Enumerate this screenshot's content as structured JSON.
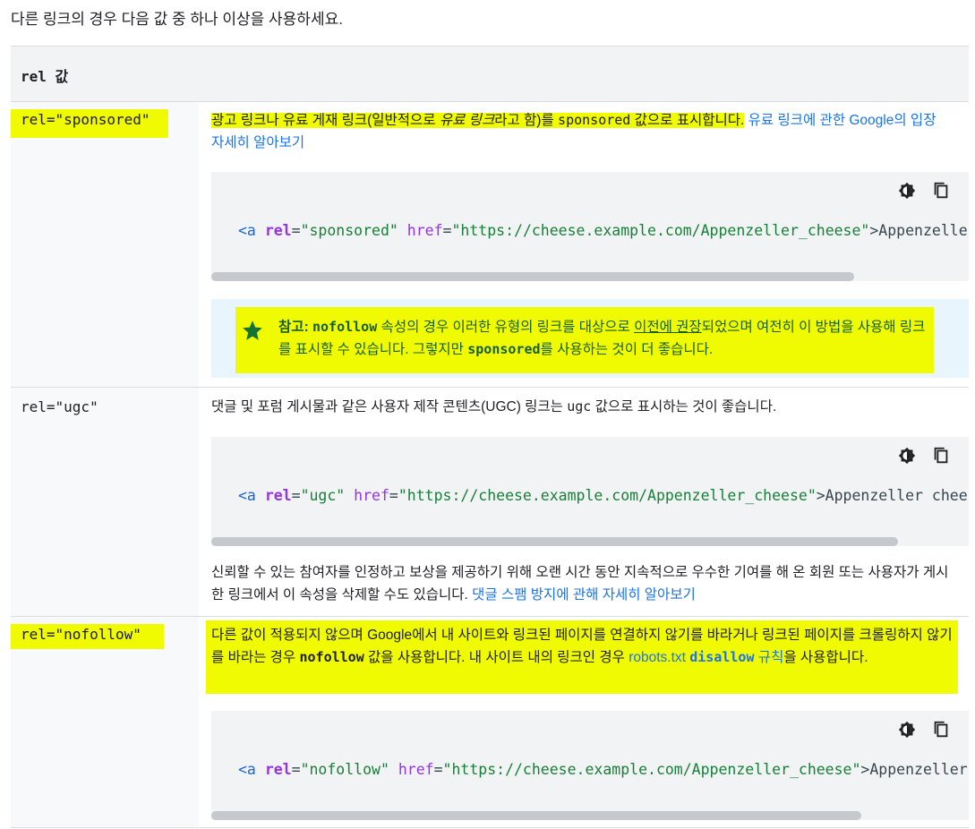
{
  "intro": "다른 링크의 경우 다음 값 중 하나 이상을 사용하세요.",
  "table": {
    "header": "rel 값",
    "rows": [
      {
        "key": "rel=\"sponsored\"",
        "desc_a": "광고 링크나 유료 게재 링크(일반적으로 ",
        "desc_em": "유료 링크",
        "desc_b": "라고 함)를 ",
        "desc_code": "sponsored",
        "desc_c": " 값으로 표시합니다.",
        "link": "유료 링크에 관한 Google의 입장 자세히 알아보기",
        "code": {
          "tag_open": "<a",
          "attr_rel": "rel",
          "eq1": "=",
          "rel_value": "\"sponsored\"",
          "attr_href": "href",
          "eq2": "=",
          "href_value": "\"https://cheese.example.com/Appenzeller_cheese\"",
          "rest": ">Appenzeller cheese</a>"
        },
        "note": {
          "bold": "참고: ",
          "code1": "nofollow",
          "t1": " 속성의 경우 이러한 유형의 링크를 대상으로 ",
          "underline": "이전에 권장",
          "t2": "되었으며 여전히 이 방법을 사용해 링크를 표시할 수 있습니다. 그렇지만 ",
          "code2": "sponsored",
          "t3": "를 사용하는 것이 더 좋습니다."
        }
      },
      {
        "key": "rel=\"ugc\"",
        "desc_a": "댓글 및 포럼 게시물과 같은 사용자 제작 콘텐츠(UGC) 링크는 ",
        "desc_code": "ugc",
        "desc_b": " 값으로 표시하는 것이 좋습니다.",
        "code": {
          "tag_open": "<a",
          "attr_rel": "rel",
          "eq1": "=",
          "rel_value": "\"ugc\"",
          "attr_href": "href",
          "eq2": "=",
          "href_value": "\"https://cheese.example.com/Appenzeller_cheese\"",
          "rest": ">Appenzeller cheese</a>"
        },
        "after": "신뢰할 수 있는 참여자를 인정하고 보상을 제공하기 위해 오랜 시간 동안 지속적으로 우수한 기여를 해 온 회원 또는 사용자가 게시한 링크에서 이 속성을 삭제할 수도 있습니다. ",
        "after_link": "댓글 스팸 방지에 관해 자세히 알아보기"
      },
      {
        "key": "rel=\"nofollow\"",
        "desc_a": "다른 값이 적용되지 않으며 Google에서 내 사이트와 링크된 페이지를 연결하지 않기를 바라거나 링크된 페이지를 크롤링하지 않기를 바라는 경우 ",
        "desc_code": "nofollow",
        "desc_b": " 값을 사용합니다. 내 사이트 내의 링크인 경우 ",
        "link_a": "robots.txt ",
        "link_code": "disallow",
        "link_b": " 규칙",
        "desc_c": "을 사용합니다.",
        "code": {
          "tag_open": "<a",
          "attr_rel": "rel",
          "eq1": "=",
          "rel_value": "\"nofollow\"",
          "attr_href": "href",
          "eq2": "=",
          "href_value": "\"https://cheese.example.com/Appenzeller_cheese\"",
          "rest": ">Appenzeller cheese</a>"
        }
      }
    ]
  },
  "icons": {
    "theme": "dark-mode-toggle-icon",
    "copy": "copy-icon",
    "note": "star-icon"
  },
  "colors": {
    "highlight": "#f0fa00",
    "link": "#1a73e8",
    "note_text": "#185e2a",
    "code_bg": "#f1f3f4",
    "note_bg": "#e8f5fd"
  }
}
